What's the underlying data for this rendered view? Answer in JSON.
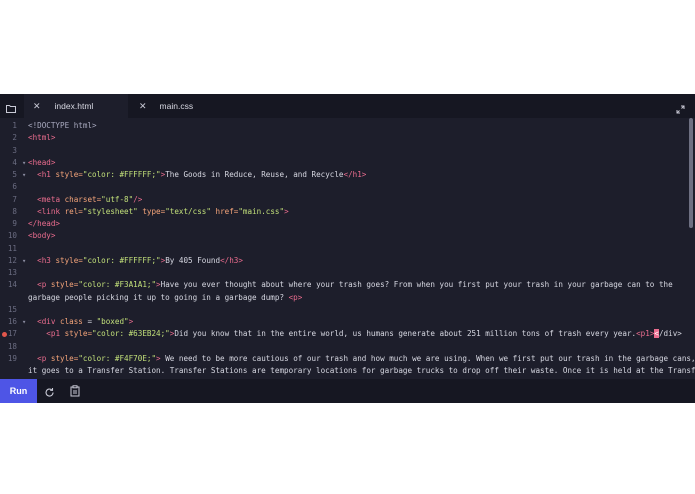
{
  "tabs": [
    {
      "label": "index.html",
      "close": "✕",
      "active": true
    },
    {
      "label": "main.css",
      "close": "✕",
      "active": false
    }
  ],
  "lines": [
    {
      "n": "1",
      "parts": [
        [
          "doc",
          "<!DOCTYPE html>"
        ]
      ]
    },
    {
      "n": "2",
      "parts": [
        [
          "tag",
          "<html>"
        ]
      ]
    },
    {
      "n": "3",
      "parts": []
    },
    {
      "n": "4",
      "fold": "▾",
      "parts": [
        [
          "tag",
          "<head>"
        ]
      ]
    },
    {
      "n": "5",
      "fold": "▾",
      "parts": [
        [
          "plain",
          "  "
        ],
        [
          "tag",
          "<h1 "
        ],
        [
          "attr",
          "style="
        ],
        [
          "str",
          "\"color: #FFFFFF;\""
        ],
        [
          "tag",
          ">"
        ],
        [
          "plain",
          "The Goods in Reduce, Reuse, and Recycle"
        ],
        [
          "tag",
          "</h1>"
        ]
      ]
    },
    {
      "n": "6",
      "parts": []
    },
    {
      "n": "7",
      "parts": [
        [
          "plain",
          "  "
        ],
        [
          "tag",
          "<meta "
        ],
        [
          "attr",
          "charset="
        ],
        [
          "str",
          "\"utf-8\""
        ],
        [
          "tag",
          "/>"
        ]
      ]
    },
    {
      "n": "8",
      "parts": [
        [
          "plain",
          "  "
        ],
        [
          "tag",
          "<link "
        ],
        [
          "attr",
          "rel="
        ],
        [
          "str",
          "\"stylesheet\""
        ],
        [
          "plain",
          " "
        ],
        [
          "attr",
          "type="
        ],
        [
          "str",
          "\"text/css\""
        ],
        [
          "plain",
          " "
        ],
        [
          "attr",
          "href="
        ],
        [
          "str",
          "\"main.css\""
        ],
        [
          "tag",
          ">"
        ]
      ]
    },
    {
      "n": "9",
      "parts": [
        [
          "tag",
          "</head>"
        ]
      ]
    },
    {
      "n": "10",
      "parts": [
        [
          "tag",
          "<body>"
        ]
      ]
    },
    {
      "n": "11",
      "parts": []
    },
    {
      "n": "12",
      "fold": "▾",
      "parts": [
        [
          "plain",
          "  "
        ],
        [
          "tag",
          "<h3 "
        ],
        [
          "attr",
          "style="
        ],
        [
          "str",
          "\"color: #FFFFFF;\""
        ],
        [
          "tag",
          ">"
        ],
        [
          "plain",
          "By 405 Found"
        ],
        [
          "tag",
          "</h3>"
        ]
      ]
    },
    {
      "n": "13",
      "parts": []
    },
    {
      "n": "14",
      "parts": [
        [
          "plain",
          "  "
        ],
        [
          "tag",
          "<p "
        ],
        [
          "attr",
          "style="
        ],
        [
          "str",
          "\"color: #F3A1A1;\""
        ],
        [
          "tag",
          ">"
        ],
        [
          "plain",
          "Have you ever thought about where your trash goes? From when you first put your trash in your garbage can to the"
        ]
      ]
    },
    {
      "n": "",
      "parts": [
        [
          "plain",
          "garbage people picking it up to going in a garbage dump? "
        ],
        [
          "tag",
          "<p>"
        ]
      ]
    },
    {
      "n": "15",
      "parts": []
    },
    {
      "n": "16",
      "fold": "▾",
      "parts": [
        [
          "plain",
          "  "
        ],
        [
          "tag",
          "<div "
        ],
        [
          "attr",
          "class"
        ],
        [
          "plain",
          " = "
        ],
        [
          "str",
          "\"boxed\""
        ],
        [
          "tag",
          ">"
        ]
      ]
    },
    {
      "n": "17",
      "breakpoint": true,
      "parts": [
        [
          "plain",
          "    "
        ],
        [
          "tag",
          "<p1 "
        ],
        [
          "attr",
          "style="
        ],
        [
          "str",
          "\"color: #63EB24;\""
        ],
        [
          "tag",
          ">"
        ],
        [
          "plain",
          "Did you know that in the entire world, us humans generate about 251 million tons of trash every year."
        ],
        [
          "tag",
          "<p1>"
        ],
        [
          "cursor",
          "<"
        ],
        [
          "plain",
          "/div>"
        ]
      ]
    },
    {
      "n": "18",
      "parts": []
    },
    {
      "n": "19",
      "parts": [
        [
          "plain",
          "  "
        ],
        [
          "tag",
          "<p "
        ],
        [
          "attr",
          "style="
        ],
        [
          "str",
          "\"color: #F4F70E;\""
        ],
        [
          "tag",
          ">"
        ],
        [
          "plain",
          " We need to be more cautious of our trash and how much we are using. When we first put our trash in the garbage cans,"
        ]
      ]
    },
    {
      "n": "",
      "parts": [
        [
          "plain",
          "it goes to a Transfer Station. Transfer Stations are temporary locations for garbage trucks to drop off their waste. Once it is held at the Transfer"
        ]
      ]
    }
  ],
  "toolbar": {
    "run_label": "Run"
  }
}
